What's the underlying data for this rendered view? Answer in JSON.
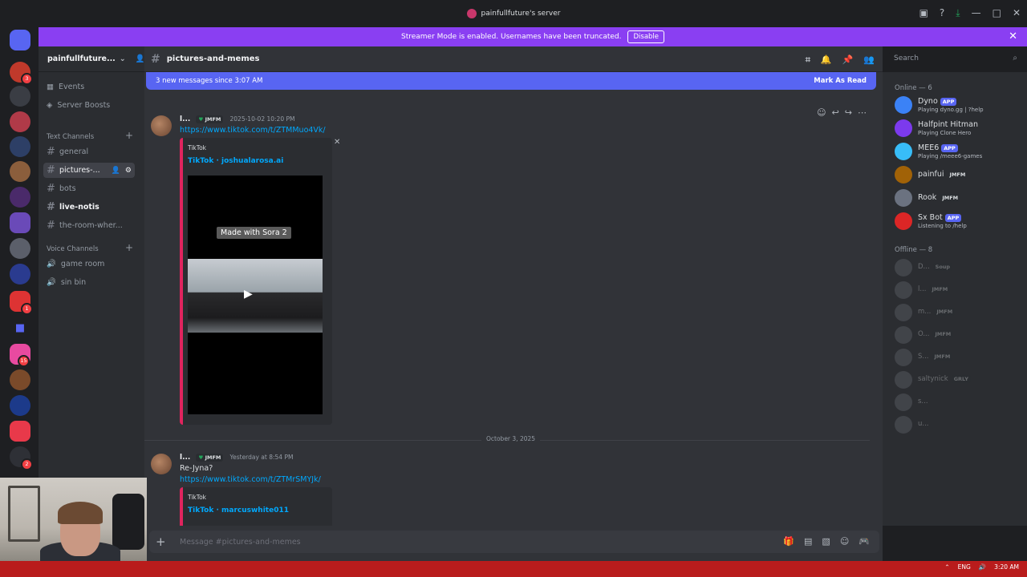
{
  "window": {
    "title": "painfullfuture's server"
  },
  "banner": {
    "text": "Streamer Mode is enabled. Usernames have been truncated.",
    "button": "Disable"
  },
  "server_rail": {
    "badges": [
      "3",
      "1",
      "15",
      "2"
    ]
  },
  "sidebar": {
    "server_name": "painfullfuture...",
    "top_items": [
      "Events",
      "Server Boosts"
    ],
    "text_category": "Text Channels",
    "text_channels": [
      "general",
      "pictures-...",
      "bots",
      "live-notis",
      "the-room-wher..."
    ],
    "voice_category": "Voice Channels",
    "voice_channels": [
      "game room",
      "sin bin"
    ]
  },
  "header": {
    "channel": "pictures-and-memes",
    "search_placeholder": "Search"
  },
  "chat": {
    "new_messages": "3 new messages since 3:07 AM",
    "mark_as_read": "Mark As Read",
    "msg1": {
      "author": "l...",
      "role": "JMFM",
      "timestamp": "2025-10-02 10:20 PM",
      "link": "https://www.tiktok.com/t/ZTMMuo4Vk/",
      "embed_provider": "TikTok",
      "embed_title": "TikTok · joshualarosa.ai",
      "video_overlay": "Made with Sora 2"
    },
    "date_divider": "October 3, 2025",
    "msg2": {
      "author": "l...",
      "role": "JMFM",
      "timestamp": "Yesterday at 8:54 PM",
      "text": "Re-Jyna?",
      "link": "https://www.tiktok.com/t/ZTMrSMYJk/",
      "embed_provider": "TikTok",
      "embed_title": "TikTok · marcuswhite011"
    }
  },
  "composer": {
    "placeholder": "Message #pictures-and-memes"
  },
  "members": {
    "online_label": "Online — 6",
    "online": [
      {
        "name": "Dyno",
        "tag": "APP",
        "activity": "Playing dyno.gg | ?help",
        "color": "#3b82f6"
      },
      {
        "name": "Halfpint Hitman",
        "tag": "",
        "activity": "Playing Clone Hero",
        "color": "#7c3aed"
      },
      {
        "name": "MEE6",
        "tag": "APP",
        "activity": "Playing /meee6-games",
        "color": "#38bdf8"
      },
      {
        "name": "painfui",
        "tag": "JMFM",
        "activity": "",
        "color": "#a16207"
      },
      {
        "name": "Rook",
        "tag": "JMFM",
        "activity": "",
        "color": "#6b7280"
      },
      {
        "name": "Sx Bot",
        "tag": "APP",
        "activity": "Listening to /help",
        "color": "#dc2626"
      }
    ],
    "offline_label": "Offline — 8",
    "offline": [
      {
        "name": "D...",
        "tag": "Soup"
      },
      {
        "name": "l...",
        "tag": "JMFM"
      },
      {
        "name": "m...",
        "tag": "JMFM"
      },
      {
        "name": "O...",
        "tag": "JMFM"
      },
      {
        "name": "S...",
        "tag": "JMFM"
      },
      {
        "name": "saltynick",
        "tag": "GRLY"
      },
      {
        "name": "s...",
        "tag": ""
      },
      {
        "name": "u...",
        "tag": ""
      }
    ]
  },
  "taskbar": {
    "lang": "ENG",
    "time": "3:20 AM"
  },
  "colors": {
    "accent": "#5865f2",
    "streamer_banner": "#8a3ff2",
    "embed_border": "#e0245e",
    "link": "#00a8fc"
  }
}
